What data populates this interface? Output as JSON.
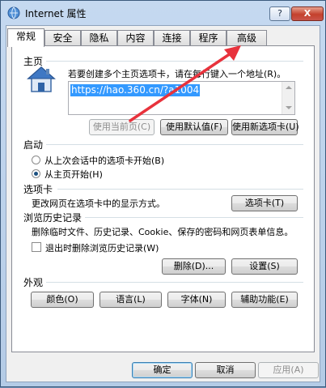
{
  "window": {
    "title": "Internet 属性",
    "help_label": "?",
    "close_label": "X"
  },
  "tabs": [
    "常规",
    "安全",
    "隐私",
    "内容",
    "连接",
    "程序",
    "高级"
  ],
  "homepage": {
    "section_label": "主页",
    "description": "若要创建多个主页选项卡，请在每行键入一个地址(R)。",
    "url": "https://hao.360.cn/?a1004",
    "use_current_label": "使用当前页(C)",
    "use_default_label": "使用默认值(F)",
    "use_new_tab_label": "使用新选项卡(U)"
  },
  "startup": {
    "section_label": "启动",
    "options": [
      {
        "label": "从上次会话中的选项卡开始(B)",
        "selected": false
      },
      {
        "label": "从主页开始(H)",
        "selected": true
      }
    ]
  },
  "tabs_section": {
    "section_label": "选项卡",
    "description": "更改网页在选项卡中的显示方式。",
    "button_label": "选项卡(T)"
  },
  "history": {
    "section_label": "浏览历史记录",
    "description": "删除临时文件、历史记录、Cookie、保存的密码和网页表单信息。",
    "checkbox_label": "退出时删除浏览历史记录(W)",
    "checkbox_checked": false,
    "delete_label": "删除(D)...",
    "settings_label": "设置(S)"
  },
  "appearance": {
    "section_label": "外观",
    "colors_label": "颜色(O)",
    "languages_label": "语言(L)",
    "fonts_label": "字体(N)",
    "accessibility_label": "辅助功能(E)"
  },
  "footer": {
    "ok_label": "确定",
    "cancel_label": "取消",
    "apply_label": "应用(A)"
  },
  "colors": {
    "annotation_arrow": "#e8323c",
    "selection": "#3399ff"
  }
}
